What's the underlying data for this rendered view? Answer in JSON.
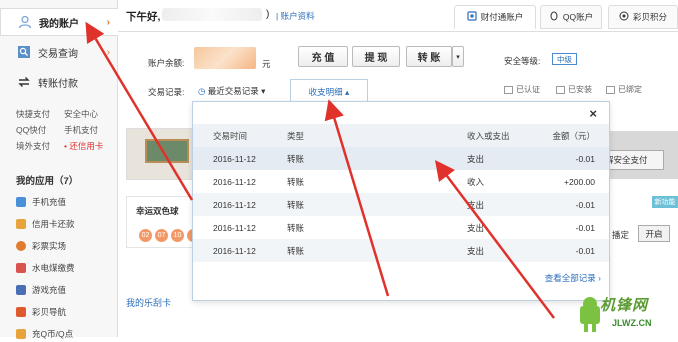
{
  "sidebar": {
    "my_account": "我的账户",
    "trade_query": "交易查询",
    "transfer_pay": "转账付款",
    "quick_links": [
      [
        "快捷支付",
        "安全中心"
      ],
      [
        "QQ快付",
        "手机支付"
      ],
      [
        "境外支付",
        "• 还信用卡"
      ]
    ],
    "apps_title": "我的应用（7）",
    "apps": [
      {
        "label": "手机充值",
        "color": "#4a90d9"
      },
      {
        "label": "信用卡还款",
        "color": "#e8a33c"
      },
      {
        "label": "彩票实场",
        "color": "#e07b2f"
      },
      {
        "label": "水电煤缴费",
        "color": "#d9534f"
      },
      {
        "label": "游戏充值",
        "color": "#4a6fb5"
      },
      {
        "label": "彩贝导航",
        "color": "#e05a2f"
      },
      {
        "label": "充Q币/Q点",
        "color": "#e8a33c"
      }
    ]
  },
  "header": {
    "greeting": "下午好,",
    "paren": ")",
    "profile_link": "| 账户资料",
    "tabs": [
      {
        "label": "财付通账户",
        "icon": "wallet-icon"
      },
      {
        "label": "QQ账户",
        "icon": "qq-icon"
      },
      {
        "label": "彩贝积分",
        "icon": "coin-icon"
      }
    ]
  },
  "balance": {
    "label": "账户余额:",
    "unit": "元",
    "buttons": [
      "充 值",
      "提 现",
      "转 账"
    ],
    "security_label": "安全等级:",
    "security_level": "中级",
    "records_label": "交易记录:",
    "recent_label": "最近交易记录 ▾",
    "detail_tab": "收支明细 ▴",
    "verifications": [
      "已认证",
      "已安装",
      "已绑定"
    ]
  },
  "dropdown": {
    "close": "×",
    "headers": [
      "交易时间",
      "类型",
      "收入或支出",
      "金额（元）"
    ],
    "rows": [
      [
        "2016-11-12",
        "转账",
        "支出",
        "-0.01"
      ],
      [
        "2016-11-12",
        "转账",
        "收入",
        "+200.00"
      ],
      [
        "2016-11-12",
        "转账",
        "支出",
        "-0.01"
      ],
      [
        "2016-11-12",
        "转账",
        "支出",
        "-0.01"
      ],
      [
        "2016-11-12",
        "转账",
        "支出",
        "-0.01"
      ]
    ],
    "view_all": "查看全部记录 ›"
  },
  "content": {
    "lottery_title": "幸运双色球",
    "balls": [
      "02",
      "07",
      "10",
      "1"
    ],
    "scratch_card": "我的乐刮卡",
    "security_btn": "了解安全支付",
    "new_feature": "新功能",
    "kai_label": "播定",
    "kai_btn": "开启"
  },
  "watermark": {
    "text": "机锋网",
    "url": "JLWZ.CN"
  },
  "colors": {
    "accent": "#e07b2f",
    "link": "#2a6ebb",
    "arrow": "#e0322b"
  }
}
